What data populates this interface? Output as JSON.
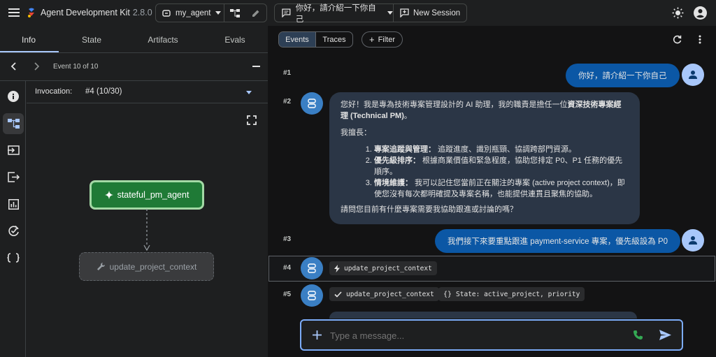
{
  "app": {
    "title": "Agent Development Kit",
    "version": "2.8.0"
  },
  "agent_selector": {
    "value": "my_agent"
  },
  "session": {
    "title": "你好，請介紹一下你自己",
    "new_session_label": "New Session"
  },
  "side_tabs": [
    {
      "label": "Info"
    },
    {
      "label": "State"
    },
    {
      "label": "Artifacts"
    },
    {
      "label": "Evals"
    }
  ],
  "event_nav": {
    "label": "Event 10 of 10"
  },
  "invocation": {
    "label": "Invocation:",
    "value": "#4 (10/30)"
  },
  "graph": {
    "root_node": "stateful_pm_agent",
    "child_node": "update_project_context"
  },
  "chat_tabs": {
    "events": "Events",
    "traces": "Traces",
    "filter": "Filter"
  },
  "messages": {
    "m1": {
      "index": "#1",
      "text": "你好，請介紹一下你自己"
    },
    "m2": {
      "index": "#2",
      "intro_plain": "您好！我是專為技術專案管理設計的 AI 助理，我的職責是擔任一位",
      "intro_bold": "資深技術專案經理 (Technical PM)",
      "intro_end": "。",
      "skills_heading": "我擅長：",
      "items": [
        {
          "title": "專案追蹤與管理：",
          "text": " 追蹤進度、識別瓶頸、協調跨部門資源。"
        },
        {
          "title": "優先級排序：",
          "text": " 根據商業價值和緊急程度，協助您排定 P0、P1 任務的優先順序。"
        },
        {
          "title": "情境維護：",
          "text": " 我可以記住您當前正在關注的專案 (active project context)，即使您沒有每次都明確提及專案名稱，也能提供連貫且聚焦的協助。"
        }
      ],
      "closing": "請問您目前有什麼專案需要我協助跟進或討論的嗎？"
    },
    "m3": {
      "index": "#3",
      "text": "我們接下來要重點跟進 payment-service 專案，優先級設為 P0"
    },
    "m4": {
      "index": "#4",
      "chip": "update_project_context"
    },
    "m5": {
      "index": "#5",
      "chip_response": "update_project_context",
      "chip_state": "State: active_project, priority"
    }
  },
  "composer": {
    "placeholder": "Type a message..."
  },
  "colors": {
    "accent": "#a8c7fa",
    "node_green": "#1f7a36",
    "user_bubble": "#0b57a5",
    "bot_bubble": "#2b3646"
  }
}
